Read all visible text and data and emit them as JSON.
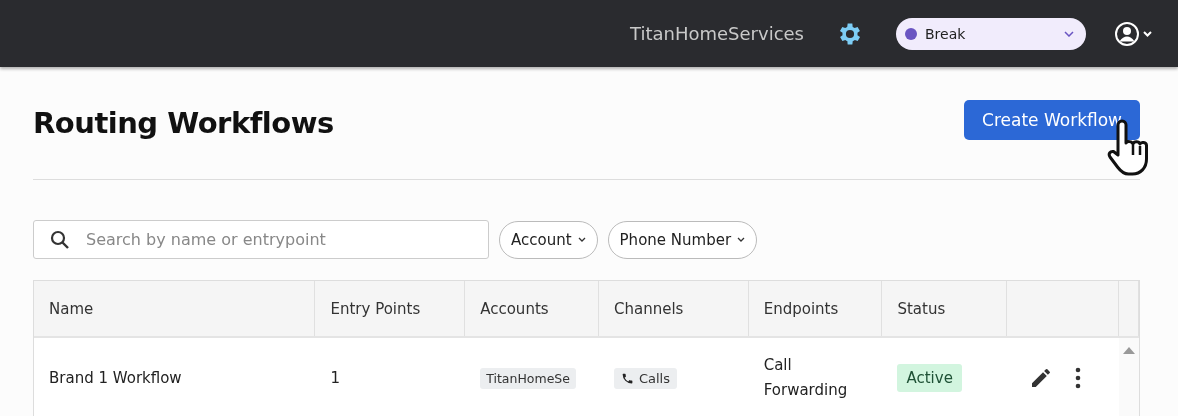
{
  "header": {
    "org_name": "TitanHomeServices",
    "presence": {
      "label": "Break",
      "color": "#6a55c2"
    }
  },
  "page": {
    "title": "Routing Workflows",
    "create_button": "Create Workflow"
  },
  "filters": {
    "search": {
      "placeholder": "Search by name or entrypoint"
    },
    "dropdowns": [
      "Account",
      "Phone Number"
    ]
  },
  "table": {
    "columns": [
      "Name",
      "Entry Points",
      "Accounts",
      "Channels",
      "Endpoints",
      "Status"
    ],
    "rows": [
      {
        "name": "Brand 1 Workflow",
        "entry_points": "1",
        "account": "TitanHomeSe",
        "channel": "Calls",
        "endpoint": "Call Forwarding",
        "status": {
          "label": "Active",
          "kind": "active"
        }
      }
    ]
  }
}
